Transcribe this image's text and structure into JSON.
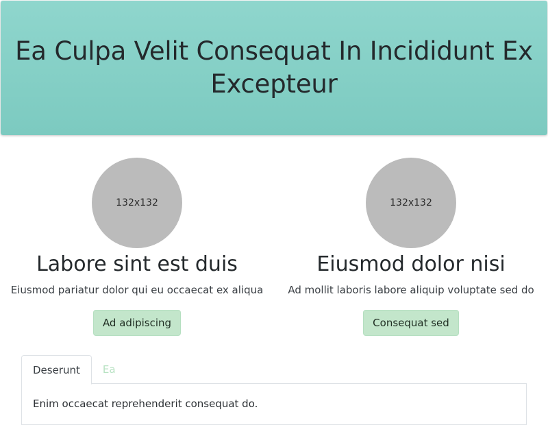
{
  "hero": {
    "title": "Ea Culpa Velit Consequat In Incididunt Ex Excepteur"
  },
  "features": [
    {
      "image_label": "132x132",
      "heading": "Labore sint est duis",
      "text": "Eiusmod pariatur dolor qui eu occaecat ex aliqua",
      "button_label": "Ad adipiscing"
    },
    {
      "image_label": "132x132",
      "heading": "Eiusmod dolor nisi",
      "text": "Ad mollit laboris labore aliquip voluptate sed do",
      "button_label": "Consequat sed"
    }
  ],
  "tabs": {
    "items": [
      {
        "label": "Deserunt",
        "active": true
      },
      {
        "label": "Ea",
        "active": false
      }
    ],
    "panel_text": "Enim occaecat reprehenderit consequat do."
  },
  "colors": {
    "hero_bg": "#8fd6cd",
    "button_bg": "#c3e6cb",
    "placeholder_bg": "#bbbbbb",
    "inactive_tab": "#b7e2c2"
  }
}
